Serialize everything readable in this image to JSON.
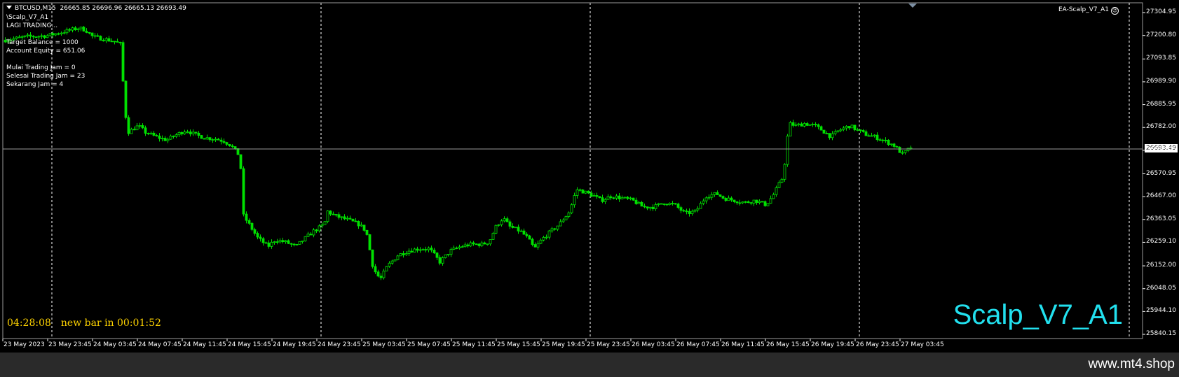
{
  "header": {
    "symbol": "BTCUSD,M15",
    "ohlc": "26665.85 26696.96 26665.13 26693.49"
  },
  "ea": {
    "label": "EA-Scalp_V7_A1",
    "smiley": "☺"
  },
  "comments": [
    "\\Scalp_V7_A1",
    "LAGI TRADING...",
    "",
    "Target Balance = 1000",
    "Account Equity = 651.06",
    "",
    "Mulai Trading Jam = 0",
    "Selesai Trading Jam = 23",
    "Sekarang Jam = 4"
  ],
  "clock": {
    "time": "04:28:08",
    "new_bar": "new bar in 00:01:52"
  },
  "watermark": "Scalp_V7_A1",
  "current_price": "26693.49",
  "footer": {
    "url": "www.mt4.shop"
  },
  "colors": {
    "candles": "#00e000",
    "axis": "#ffffff",
    "grid": "#ffffff",
    "clock": "#ffd400",
    "watermark": "#22e0ee"
  },
  "chart_data": {
    "type": "candlestick",
    "symbol": "BTCUSD",
    "timeframe": "M15",
    "ylim": [
      25840.15,
      27304.95
    ],
    "price_ticks": [
      "27304.95",
      "27200.80",
      "27093.85",
      "26989.90",
      "26885.95",
      "26782.00",
      "26678.05",
      "26570.95",
      "26467.00",
      "26363.05",
      "26259.10",
      "26152.00",
      "26048.05",
      "25944.10",
      "25840.15"
    ],
    "time_ticks": [
      "23 May 2023",
      "23 May 23:45",
      "24 May 03:45",
      "24 May 07:45",
      "24 May 11:45",
      "24 May 15:45",
      "24 May 19:45",
      "24 May 23:45",
      "25 May 03:45",
      "25 May 07:45",
      "25 May 11:45",
      "25 May 15:45",
      "25 May 19:45",
      "25 May 23:45",
      "26 May 03:45",
      "26 May 07:45",
      "26 May 11:45",
      "26 May 15:45",
      "26 May 19:45",
      "26 May 23:45",
      "27 May 03:45"
    ],
    "price_path": [
      [
        0,
        27180
      ],
      [
        30,
        27195
      ],
      [
        60,
        27200
      ],
      [
        80,
        27215
      ],
      [
        105,
        27235
      ],
      [
        115,
        27225
      ],
      [
        125,
        27195
      ],
      [
        140,
        27185
      ],
      [
        155,
        27175
      ],
      [
        165,
        27160
      ],
      [
        170,
        26880
      ],
      [
        175,
        26760
      ],
      [
        190,
        26790
      ],
      [
        200,
        26760
      ],
      [
        215,
        26740
      ],
      [
        230,
        26725
      ],
      [
        245,
        26750
      ],
      [
        258,
        26770
      ],
      [
        270,
        26750
      ],
      [
        285,
        26735
      ],
      [
        300,
        26730
      ],
      [
        312,
        26720
      ],
      [
        322,
        26700
      ],
      [
        335,
        26650
      ],
      [
        340,
        26380
      ],
      [
        350,
        26330
      ],
      [
        360,
        26280
      ],
      [
        375,
        26240
      ],
      [
        385,
        26270
      ],
      [
        400,
        26260
      ],
      [
        415,
        26240
      ],
      [
        425,
        26270
      ],
      [
        440,
        26310
      ],
      [
        455,
        26340
      ],
      [
        460,
        26400
      ],
      [
        470,
        26380
      ],
      [
        490,
        26360
      ],
      [
        505,
        26340
      ],
      [
        515,
        26310
      ],
      [
        525,
        26140
      ],
      [
        535,
        26090
      ],
      [
        545,
        26150
      ],
      [
        560,
        26200
      ],
      [
        575,
        26220
      ],
      [
        590,
        26230
      ],
      [
        605,
        26230
      ],
      [
        620,
        26170
      ],
      [
        635,
        26220
      ],
      [
        650,
        26240
      ],
      [
        665,
        26250
      ],
      [
        680,
        26250
      ],
      [
        690,
        26260
      ],
      [
        700,
        26330
      ],
      [
        710,
        26370
      ],
      [
        720,
        26330
      ],
      [
        735,
        26310
      ],
      [
        745,
        26280
      ],
      [
        755,
        26230
      ],
      [
        765,
        26270
      ],
      [
        775,
        26300
      ],
      [
        790,
        26340
      ],
      [
        805,
        26400
      ],
      [
        815,
        26500
      ],
      [
        825,
        26490
      ],
      [
        840,
        26470
      ],
      [
        850,
        26450
      ],
      [
        865,
        26470
      ],
      [
        880,
        26460
      ],
      [
        895,
        26450
      ],
      [
        910,
        26420
      ],
      [
        925,
        26420
      ],
      [
        940,
        26440
      ],
      [
        955,
        26430
      ],
      [
        970,
        26390
      ],
      [
        985,
        26400
      ],
      [
        1000,
        26470
      ],
      [
        1015,
        26480
      ],
      [
        1025,
        26460
      ],
      [
        1040,
        26450
      ],
      [
        1055,
        26440
      ],
      [
        1070,
        26450
      ],
      [
        1085,
        26430
      ],
      [
        1095,
        26470
      ],
      [
        1110,
        26560
      ],
      [
        1118,
        26800
      ],
      [
        1128,
        26790
      ],
      [
        1140,
        26800
      ],
      [
        1155,
        26790
      ],
      [
        1165,
        26770
      ],
      [
        1178,
        26740
      ],
      [
        1190,
        26770
      ],
      [
        1205,
        26790
      ],
      [
        1215,
        26770
      ],
      [
        1228,
        26750
      ],
      [
        1240,
        26740
      ],
      [
        1255,
        26720
      ],
      [
        1268,
        26700
      ],
      [
        1280,
        26660
      ],
      [
        1293,
        26693.49
      ]
    ]
  }
}
